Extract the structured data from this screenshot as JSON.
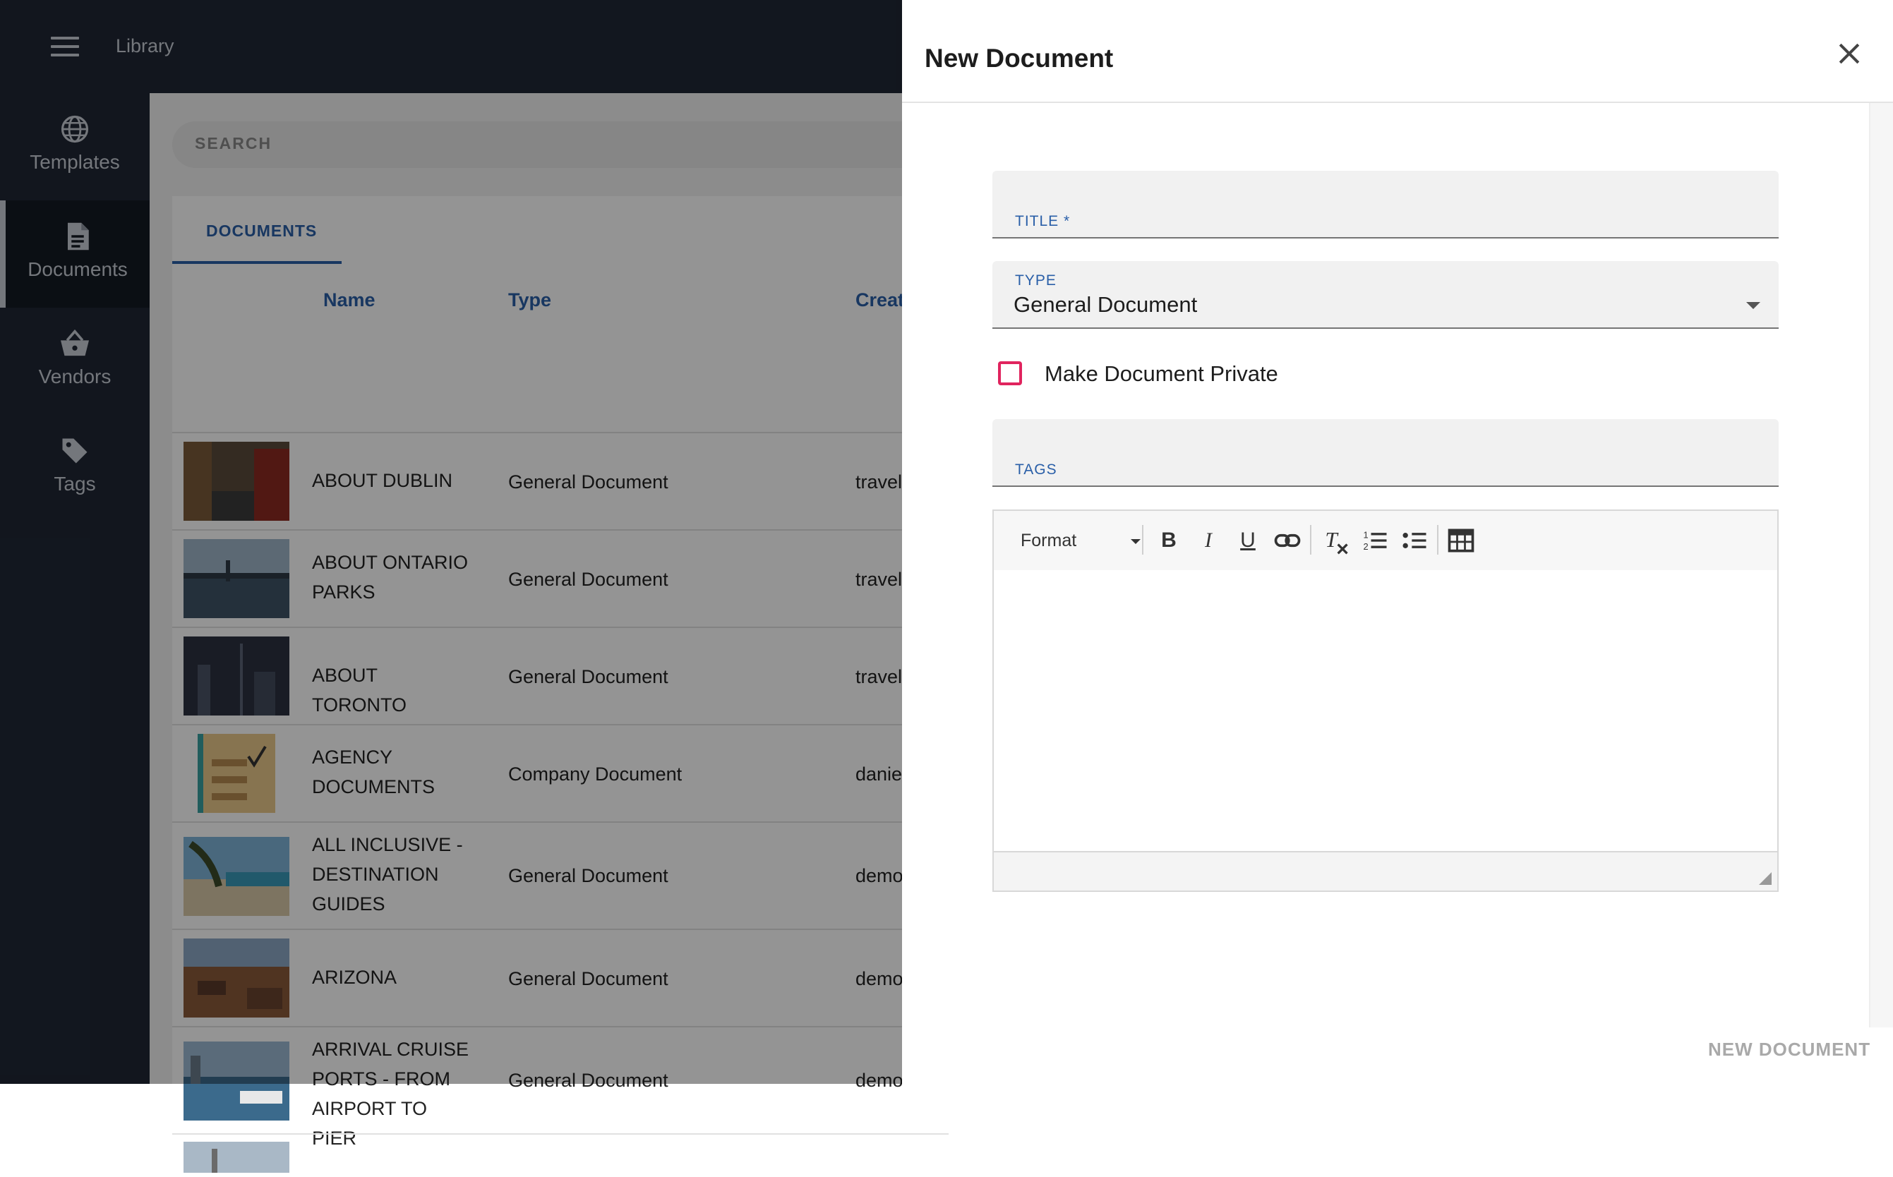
{
  "app": {
    "title": "Library"
  },
  "sidebar": {
    "items": [
      {
        "label": "Templates",
        "icon": "globe-icon"
      },
      {
        "label": "Documents",
        "icon": "document-icon",
        "active": true
      },
      {
        "label": "Vendors",
        "icon": "basket-icon"
      },
      {
        "label": "Tags",
        "icon": "tag-icon"
      }
    ]
  },
  "search": {
    "placeholder": "SEARCH"
  },
  "tabs": {
    "documents": "DOCUMENTS"
  },
  "table": {
    "columns": [
      "Name",
      "Type",
      "Creat"
    ],
    "rows": [
      {
        "name": "ABOUT DUBLIN",
        "type": "General Document",
        "created": "travel"
      },
      {
        "name": "ABOUT ONTARIO PARKS",
        "type": "General Document",
        "created": "travel"
      },
      {
        "name": "ABOUT TORONTO",
        "type": "General Document",
        "created": "travel"
      },
      {
        "name": "AGENCY DOCUMENTS",
        "type": "Company Document",
        "created": "danie"
      },
      {
        "name": "ALL INCLUSIVE - DESTINATION GUIDES",
        "type": "General Document",
        "created": "demo"
      },
      {
        "name": "ARIZONA",
        "type": "General Document",
        "created": "demo"
      },
      {
        "name": "ARRIVAL CRUISE PORTS - FROM AIRPORT TO PIER",
        "type": "General Document",
        "created": "demo"
      }
    ]
  },
  "dialog": {
    "title": "New Document",
    "title_field_label": "TITLE *",
    "type_field_label": "TYPE",
    "type_value": "General Document",
    "private_label": "Make Document Private",
    "tags_label": "TAGS",
    "editor": {
      "format_label": "Format"
    },
    "submit_label": "NEW DOCUMENT"
  },
  "colors": {
    "accent": "#2a5fa8",
    "checkbox": "#e0245e",
    "sidebar": "#1f2735"
  }
}
